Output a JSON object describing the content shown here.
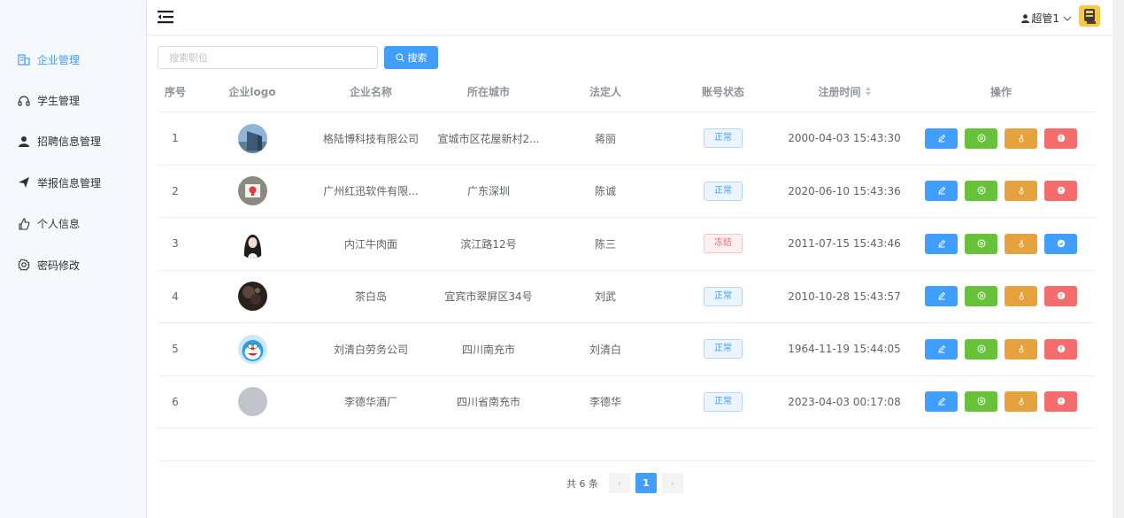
{
  "sidebar": {
    "items": [
      {
        "label": "企业管理",
        "icon": "building-icon",
        "active": true
      },
      {
        "label": "学生管理",
        "icon": "headset-icon",
        "active": false
      },
      {
        "label": "招聘信息管理",
        "icon": "user-icon",
        "active": false
      },
      {
        "label": "举报信息管理",
        "icon": "send-icon",
        "active": false
      },
      {
        "label": "个人信息",
        "icon": "thumb-icon",
        "active": false
      },
      {
        "label": "密码修改",
        "icon": "settings-icon",
        "active": false
      }
    ]
  },
  "header": {
    "user_name": "超管1"
  },
  "search": {
    "placeholder": "搜索职位",
    "button_label": "搜索"
  },
  "table": {
    "columns": [
      "序号",
      "企业logo",
      "企业名称",
      "所在城市",
      "法定人",
      "账号状态",
      "注册时间",
      "操作"
    ],
    "rows": [
      {
        "index": "1",
        "name": "格陆博科技有限公司",
        "city": "宣城市区花屋新村2...",
        "legal": "蒋丽",
        "status": "正常",
        "status_type": "ok",
        "time": "2000-04-03 15:43:30",
        "logo": "building-photo"
      },
      {
        "index": "2",
        "name": "广州红迅软件有限...",
        "city": "广东深圳",
        "legal": "陈诚",
        "status": "正常",
        "status_type": "ok",
        "time": "2020-06-10 15:43:36",
        "logo": "red-logo"
      },
      {
        "index": "3",
        "name": "内江牛肉面",
        "city": "滨江路12号",
        "legal": "陈三",
        "status": "冻结",
        "status_type": "frozen",
        "time": "2011-07-15 15:43:46",
        "logo": "girl-portrait"
      },
      {
        "index": "4",
        "name": "茶白岛",
        "city": "宜宾市翠屏区34号",
        "legal": "刘武",
        "status": "正常",
        "status_type": "ok",
        "time": "2010-10-28 15:43:57",
        "logo": "dark-portrait"
      },
      {
        "index": "5",
        "name": "刘清白劳务公司",
        "city": "四川南充市",
        "legal": "刘清白",
        "status": "正常",
        "status_type": "ok",
        "time": "1964-11-19 15:44:05",
        "logo": "doraemon"
      },
      {
        "index": "6",
        "name": "李德华酒厂",
        "city": "四川省南充市",
        "legal": "李德华",
        "status": "正常",
        "status_type": "ok",
        "time": "2023-04-03 00:17:08",
        "logo": "gray-placeholder"
      }
    ]
  },
  "pagination": {
    "total_text": "共 6 条",
    "current_page": "1",
    "prev": "‹",
    "next": "›"
  },
  "colors": {
    "primary": "#409eff",
    "success": "#67c23a",
    "warning": "#e6a23c",
    "danger": "#f56c6c"
  }
}
